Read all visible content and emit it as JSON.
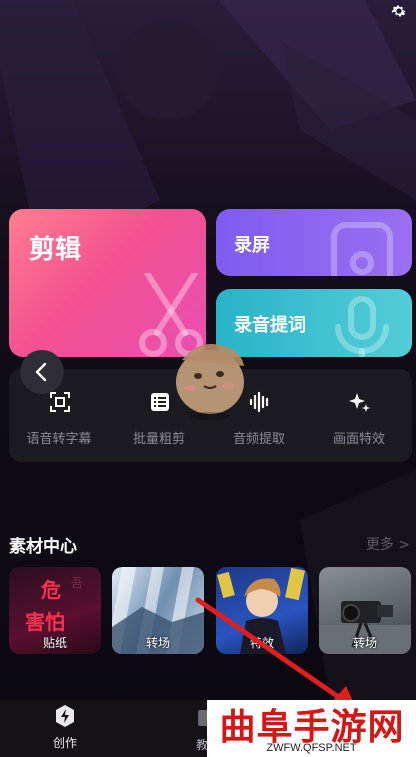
{
  "cards": {
    "edit_label": "剪辑",
    "record_label": "录屏",
    "prompt_label": "录音提词"
  },
  "tools": [
    {
      "label": "语音转字幕",
      "icon": "subtitle-icon"
    },
    {
      "label": "批量粗剪",
      "icon": "list-icon"
    },
    {
      "label": "音频提取",
      "icon": "waveform-icon"
    },
    {
      "label": "画面特效",
      "icon": "sparkle-icon"
    }
  ],
  "materials": {
    "title": "素材中心",
    "more": "更多 >",
    "items": [
      {
        "label": "贴纸",
        "art_text": "害怕"
      },
      {
        "label": "转场"
      },
      {
        "label": "特效"
      },
      {
        "label": "转场"
      }
    ]
  },
  "bottom_nav": {
    "create_label": "创作",
    "second_label": "教"
  },
  "watermark": {
    "title": "曲阜手游网",
    "url": "ZWFW.QFSP.NET"
  },
  "colors": {
    "edit_card": "#f3518f",
    "record_card": "#8a66f0",
    "prompt_card": "#3fc2cf",
    "watermark_red": "#d71515"
  }
}
